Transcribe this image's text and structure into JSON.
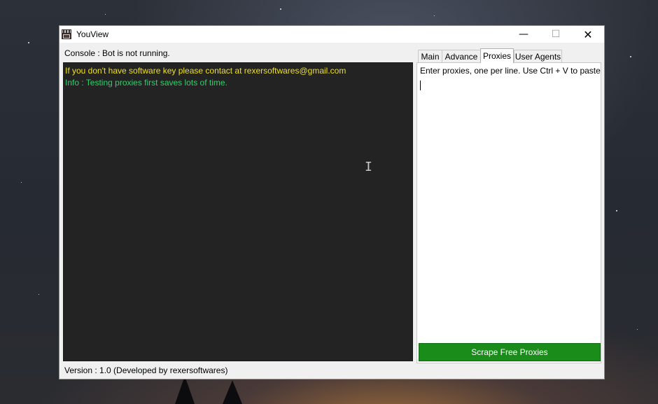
{
  "window": {
    "title": "YouView",
    "controls": {
      "minimize": "—",
      "maximize": "☐",
      "close": "✕"
    }
  },
  "console": {
    "label": "Console : Bot is not running.",
    "lines": [
      {
        "text": "If you don't have software key please contact at rexersoftwares@gmail.com",
        "color": "#f0e020"
      },
      {
        "text": "Info : Testing proxies first saves lots of time.",
        "color": "#2ed06a"
      }
    ]
  },
  "tabs": [
    {
      "label": "Main",
      "active": false
    },
    {
      "label": "Advance",
      "active": false
    },
    {
      "label": "Proxies",
      "active": true
    },
    {
      "label": "User Agents",
      "active": false
    }
  ],
  "proxies": {
    "hint": "Enter proxies, one per line. Use Ctrl + V to paste",
    "value": "",
    "scrape_button": "Scrape Free Proxies",
    "scrape_button_color": "#1a8c1a"
  },
  "footer": {
    "version": "Version : 1.0 (Developed by rexersoftwares)"
  },
  "icons": {
    "app": "film-clapper-icon",
    "cursor": "text-cursor-icon"
  }
}
